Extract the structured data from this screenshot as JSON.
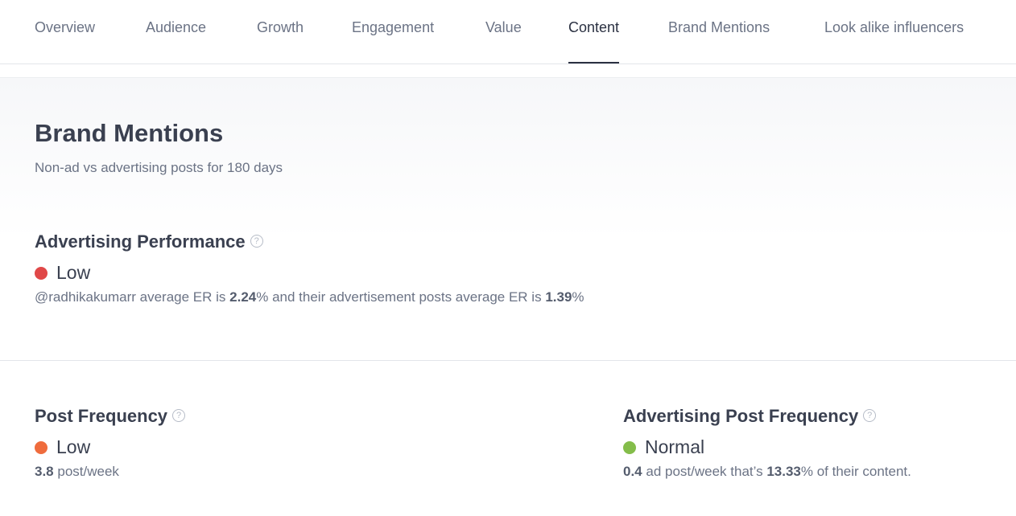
{
  "tabs": [
    {
      "label": "Overview",
      "active": false
    },
    {
      "label": "Audience",
      "active": false
    },
    {
      "label": "Growth",
      "active": false
    },
    {
      "label": "Engagement",
      "active": false
    },
    {
      "label": "Value",
      "active": false
    },
    {
      "label": "Content",
      "active": true
    },
    {
      "label": "Brand Mentions",
      "active": false
    },
    {
      "label": "Look alike influencers",
      "active": false
    }
  ],
  "section": {
    "title": "Brand Mentions",
    "subtitle": "Non-ad vs advertising posts for 180 days"
  },
  "advertising_performance": {
    "title": "Advertising Performance",
    "help_icon": "question-circle-icon",
    "status": "Low",
    "status_color": "#e04848",
    "handle": "@radhikakumarr",
    "text_1": " average ER is ",
    "avg_er": "2.24",
    "text_2": "% and their advertisement posts average ER is ",
    "ad_er": "1.39",
    "text_3": "%"
  },
  "post_frequency": {
    "title": "Post Frequency",
    "help_icon": "question-circle-icon",
    "status": "Low",
    "status_color": "#ef6c3d",
    "value": "3.8",
    "unit": " post/week"
  },
  "ad_post_frequency": {
    "title": "Advertising Post Frequency",
    "help_icon": "question-circle-icon",
    "status": "Normal",
    "status_color": "#84bd4a",
    "value": "0.4",
    "text_1": " ad post/week that’s ",
    "percent": "13.33",
    "text_2": "% of their content."
  }
}
